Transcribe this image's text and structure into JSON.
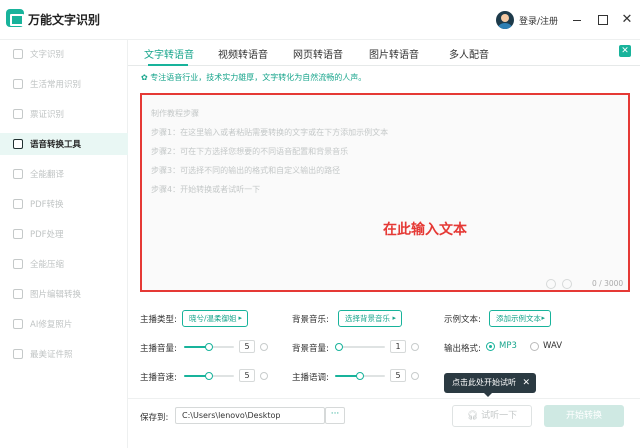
{
  "app": {
    "title": "万能文字识别",
    "login_label": "登录/注册"
  },
  "window_controls": {
    "close_glyph": "✕"
  },
  "sidebar": {
    "items": [
      {
        "label": "文字识别",
        "icon": "text-scan-icon",
        "active": false
      },
      {
        "label": "生活常用识别",
        "icon": "life-scan-icon",
        "active": false
      },
      {
        "label": "票证识别",
        "icon": "ticket-scan-icon",
        "active": false
      },
      {
        "label": "语音转换工具",
        "icon": "voice-convert-icon",
        "active": true
      },
      {
        "label": "全能翻译",
        "icon": "translate-icon",
        "active": false
      },
      {
        "label": "PDF转换",
        "icon": "pdf-convert-icon",
        "active": false
      },
      {
        "label": "PDF处理",
        "icon": "pdf-process-icon",
        "active": false
      },
      {
        "label": "全能压缩",
        "icon": "compress-icon",
        "active": false
      },
      {
        "label": "图片编辑转换",
        "icon": "image-edit-icon",
        "active": false
      },
      {
        "label": "AI修复照片",
        "icon": "ai-photo-icon",
        "active": false
      },
      {
        "label": "最美证件照",
        "icon": "id-photo-icon",
        "active": false
      }
    ]
  },
  "tabs": [
    {
      "label": "文字转语音",
      "active": true
    },
    {
      "label": "视频转语音",
      "active": false
    },
    {
      "label": "网页转语音",
      "active": false
    },
    {
      "label": "图片转语音",
      "active": false
    },
    {
      "label": "多人配音",
      "active": false
    }
  ],
  "hint": "专注语音行业，技术实力雄厚，文字转化为自然流畅的人声。",
  "editor": {
    "lines": [
      "制作教程步骤",
      "步骤1：在这里输入或者粘贴需要转换的文字或在下方添加示例文本",
      "步骤2：可在下方选择您想要的不同语音配置和背景音乐",
      "步骤3：可选择不同的输出的格式和自定义输出的路径",
      "步骤4：开始转换或者试听一下"
    ],
    "overlay_text": "在此输入文本",
    "char_count": "0 / 3000"
  },
  "settings": {
    "anchor_type_label": "主播类型:",
    "anchor_type_button": "晓兮/温柔御姐",
    "bgm_label": "背景音乐:",
    "bgm_button": "选择背景音乐",
    "sample_label": "示例文本:",
    "sample_button": "添加示例文本",
    "anchor_volume_label": "主播音量:",
    "anchor_volume_value": "5",
    "anchor_volume_fraction": 0.5,
    "bgm_volume_label": "背景音量:",
    "bgm_volume_value": "1",
    "bgm_volume_fraction": 0.0,
    "format_label": "输出格式:",
    "format_options": [
      "MP3",
      "WAV"
    ],
    "format_selected": "MP3",
    "anchor_speed_label": "主播音速:",
    "anchor_speed_value": "5",
    "anchor_speed_fraction": 0.5,
    "anchor_tone_label": "主播语调:",
    "anchor_tone_value": "5",
    "anchor_tone_fraction": 0.5
  },
  "tooltip": {
    "text": "点击此处开始试听",
    "close": "✕"
  },
  "footer": {
    "save_label": "保存到:",
    "save_path": "C:\\Users\\lenovo\\Desktop",
    "browse": "···",
    "try_button": "试听一下",
    "start_button": "开始转换"
  },
  "colors": {
    "accent": "#18b39b",
    "highlight": "#e53935"
  }
}
